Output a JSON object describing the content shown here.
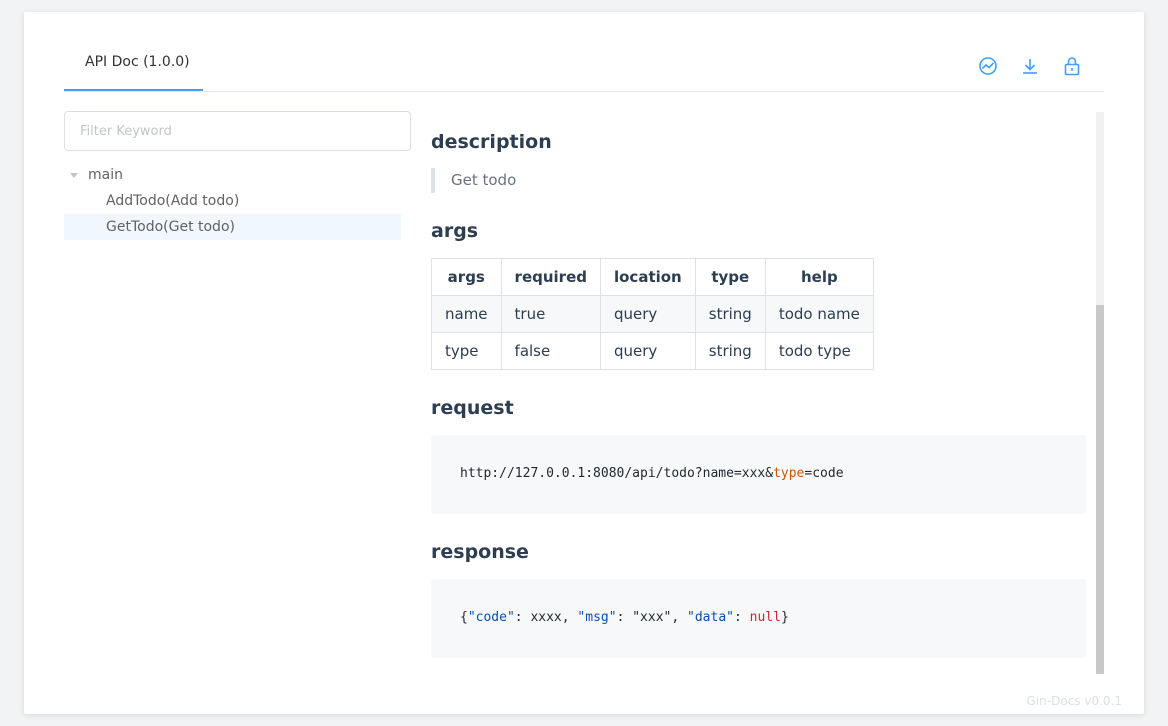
{
  "header": {
    "tab_label": "API Doc (1.0.0)",
    "icons": [
      "share-icon",
      "download-icon",
      "lock-icon"
    ],
    "accent_color": "#409eff"
  },
  "sidebar": {
    "filter_placeholder": "Filter Keyword",
    "tree": {
      "root_label": "main",
      "items": [
        {
          "label": "AddTodo(Add todo)",
          "selected": false
        },
        {
          "label": "GetTodo(Get todo)",
          "selected": true
        }
      ]
    }
  },
  "main": {
    "description_heading": "description",
    "description_text": "Get todo",
    "args_heading": "args",
    "args_table": {
      "headers": [
        "args",
        "required",
        "location",
        "type",
        "help"
      ],
      "rows": [
        [
          "name",
          "true",
          "query",
          "string",
          "todo name"
        ],
        [
          "type",
          "false",
          "query",
          "string",
          "todo type"
        ]
      ]
    },
    "request_heading": "request",
    "request_code": {
      "prefix": "http://127.0.0.1:8080/api/todo?name=xxx&",
      "keyword": "type",
      "suffix": "=code"
    },
    "response_heading": "response",
    "response_code": {
      "open": "{",
      "key_code": "\"code\"",
      "sep1": ": xxxx, ",
      "key_msg": "\"msg\"",
      "sep2": ": ",
      "val_msg": "\"xxx\"",
      "sep3": ", ",
      "key_data": "\"data\"",
      "sep4": ": ",
      "val_data": "null",
      "close": "}"
    }
  },
  "footer": {
    "version": "Gin-Docs v0.0.1"
  }
}
